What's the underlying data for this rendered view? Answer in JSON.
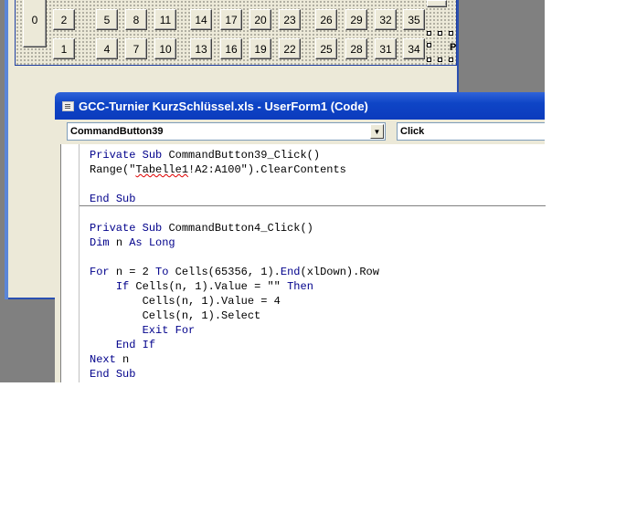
{
  "userform": {
    "buttons_top_row": [
      "2",
      "5",
      "8",
      "11",
      "14",
      "17",
      "20",
      "23",
      "26",
      "29",
      "32",
      "35"
    ],
    "buttons_bottom_row": [
      "1",
      "4",
      "7",
      "10",
      "13",
      "16",
      "19",
      "22",
      "25",
      "28",
      "31",
      "34"
    ],
    "left_button": "0",
    "p_label": "P"
  },
  "code_window": {
    "title": "GCC-Turnier KurzSchlüssel.xls - UserForm1 (Code)",
    "object_combo": "CommandButton39",
    "procedure_combo": "Click",
    "lines": [
      "Private Sub CommandButton39_Click()",
      "Range(\"Tabelle1!A2:A100\").ClearContents",
      "",
      "End Sub",
      "",
      "Private Sub CommandButton4_Click()",
      "Dim n As Long",
      "",
      "For n = 2 To Cells(65356, 1).End(xlDown).Row",
      "    If Cells(n, 1).Value = \"\" Then",
      "        Cells(n, 1).Value = 4",
      "        Cells(n, 1).Select",
      "        Exit For",
      "    End If",
      "Next n",
      "End Sub"
    ]
  },
  "colors": {
    "title_bar": "#0b3bbd",
    "keyword": "#00008b",
    "error_squiggle": "#e00000"
  }
}
